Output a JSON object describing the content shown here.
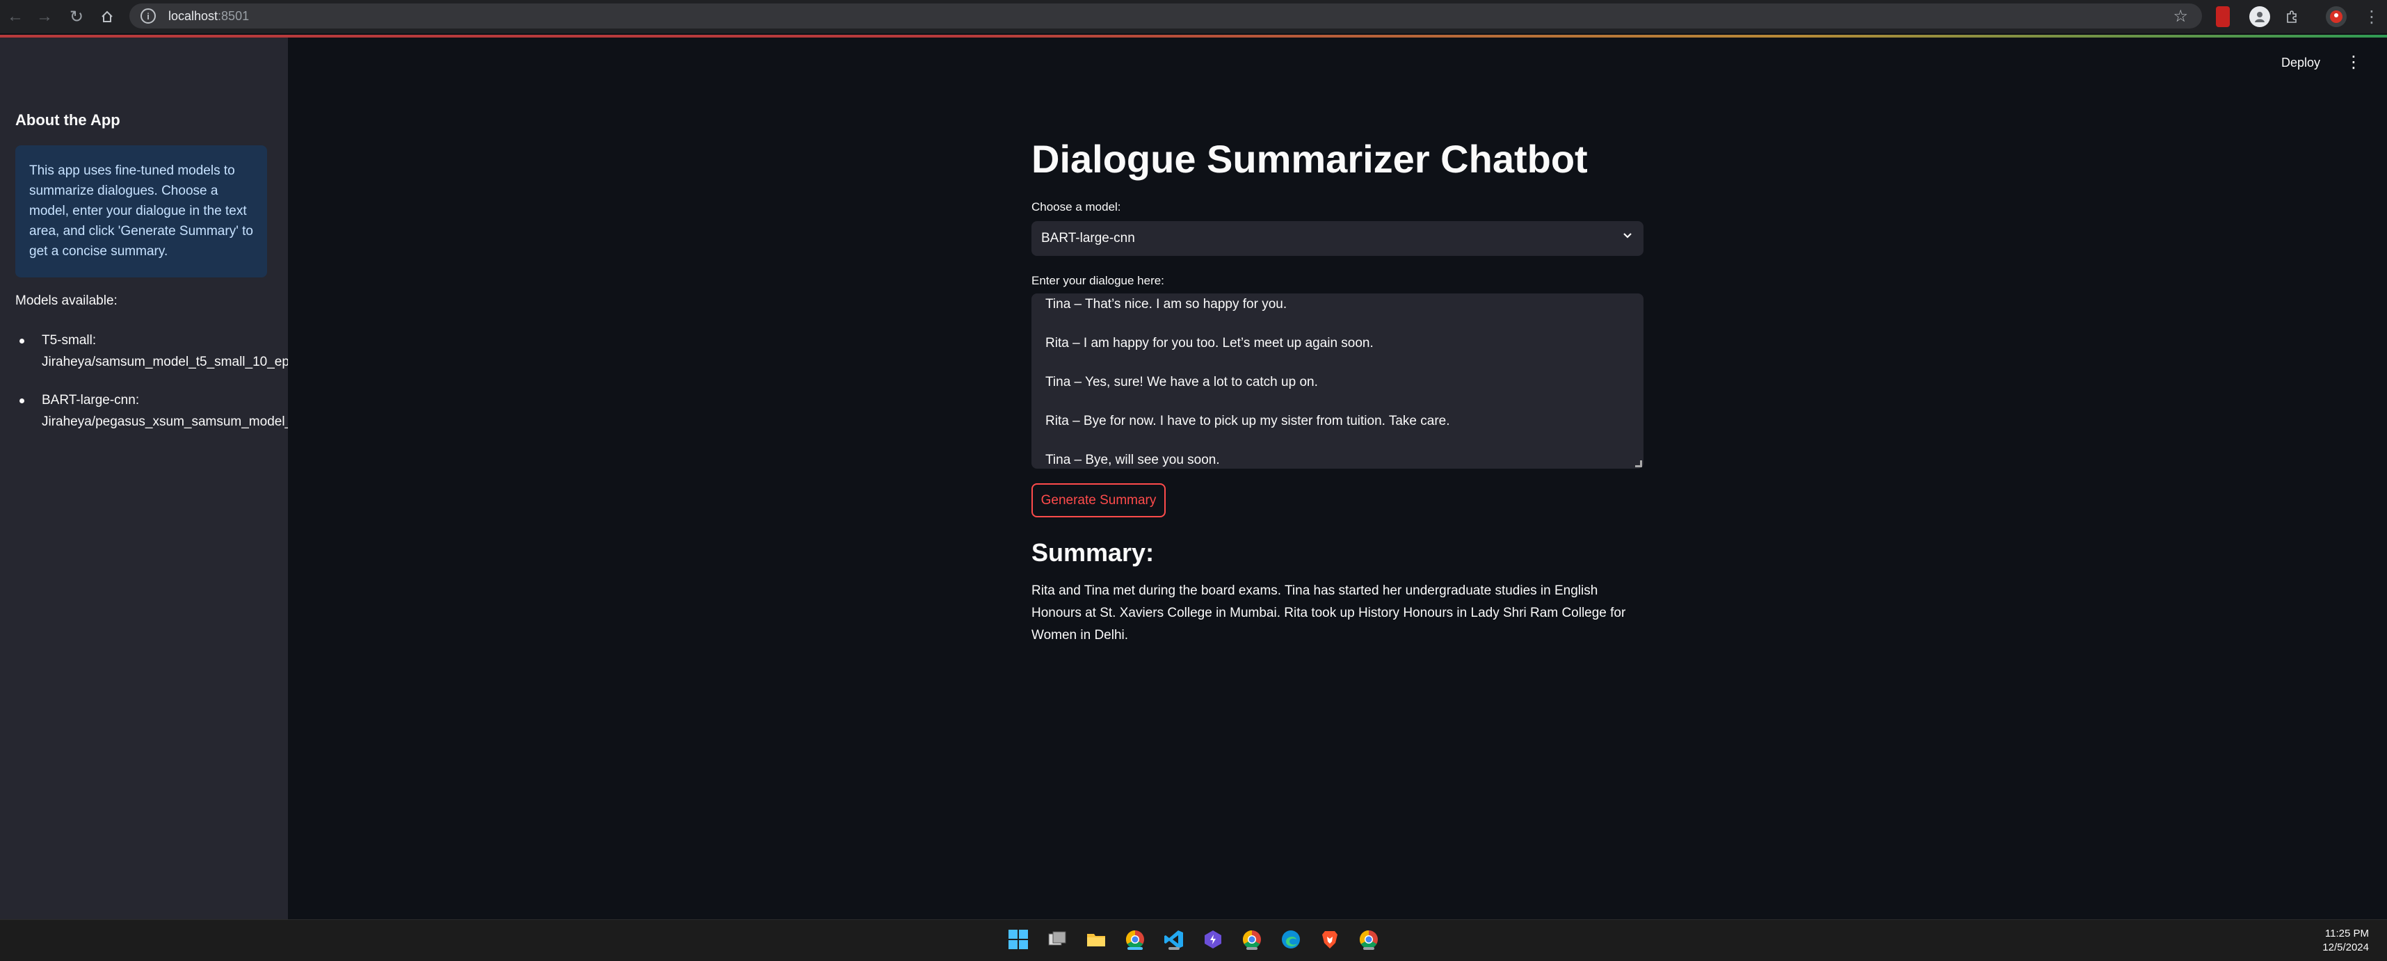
{
  "browser": {
    "url_host": "localhost",
    "url_port": ":8501"
  },
  "header": {
    "deploy_label": "Deploy"
  },
  "sidebar": {
    "title": "About the App",
    "info_text": "This app uses fine-tuned models to summarize dialogues. Choose a model, enter your dialogue in the text area, and click 'Generate Summary' to get a concise summary.",
    "models_heading": "Models available:",
    "models": [
      {
        "name": "T5-small:",
        "repo": "Jiraheya/samsum_model_t5_small_10_ep"
      },
      {
        "name": "BART-large-cnn:",
        "repo": "Jiraheya/pegasus_xsum_samsum_model_"
      }
    ]
  },
  "main": {
    "title": "Dialogue Summarizer Chatbot",
    "model_label": "Choose a model:",
    "model_selected": "BART-large-cnn",
    "dialogue_label": "Enter your dialogue here:",
    "dialogue_lines": [
      "Tina – That’s nice. I am so happy for you.",
      "Rita – I am happy for you too. Let’s meet up again soon.",
      "Tina – Yes, sure! We have a lot to catch up on.",
      "Rita – Bye for now. I have to pick up my sister from tuition. Take care.",
      "Tina – Bye, will see you soon."
    ],
    "button_label": "Generate Summary",
    "summary_title": "Summary:",
    "summary_text": "Rita and Tina met during the board exams. Tina has started her undergraduate studies in English Honours at St. Xaviers College in Mumbai. Rita took up History Honours in Lady Shri Ram College for Women in Delhi."
  },
  "taskbar": {
    "time": "11:25 PM",
    "date": "12/5/2024"
  },
  "colors": {
    "accent": "#ff4b4b",
    "background": "#0e1117",
    "sidebar": "#262730",
    "info_box": "#1c3350"
  }
}
